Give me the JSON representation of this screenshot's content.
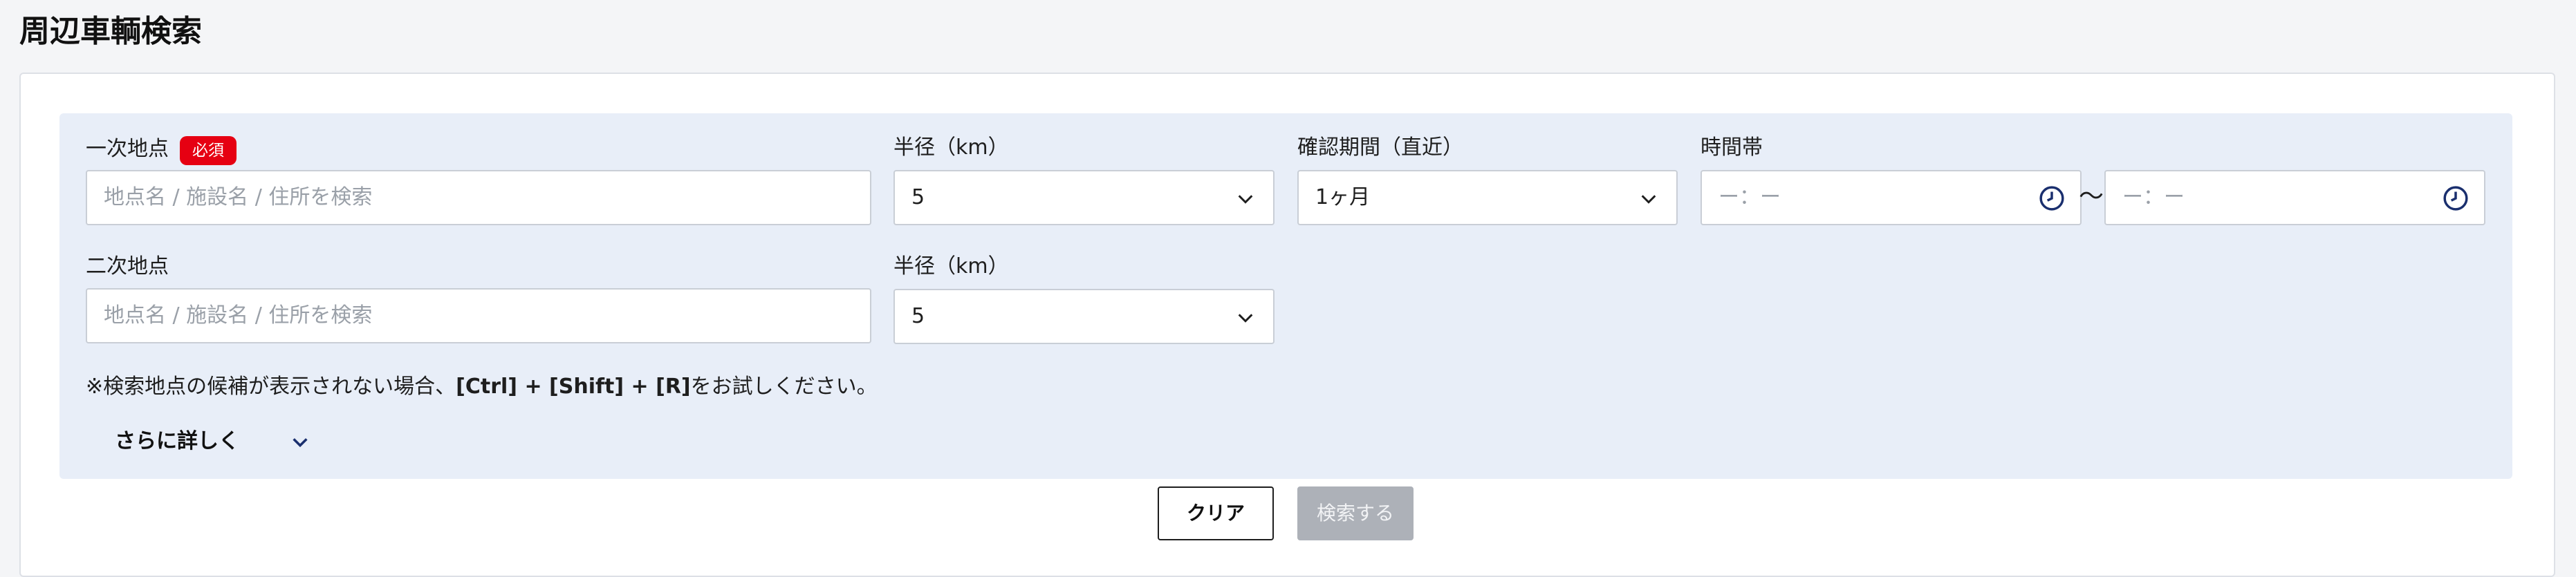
{
  "page": {
    "title": "周辺車輌検索"
  },
  "primary": {
    "label": "一次地点",
    "required_badge": "必須",
    "placeholder": "地点名 / 施設名 / 住所を検索"
  },
  "radius1": {
    "label": "半径（km）",
    "value": "5"
  },
  "period": {
    "label": "確認期間（直近）",
    "value": "1ヶ月"
  },
  "timeband": {
    "label": "時間帯",
    "from": "ー：ー",
    "separator": "〜",
    "to": "ー：ー"
  },
  "secondary": {
    "label": "二次地点",
    "placeholder": "地点名 / 施設名 / 住所を検索"
  },
  "radius2": {
    "label": "半径（km）",
    "value": "5"
  },
  "note": {
    "prefix": "※検索地点の候補が表示されない場合、",
    "keys": "[Ctrl] + [Shift] + [R]",
    "suffix": "をお試しください。"
  },
  "more": {
    "label": "さらに詳しく"
  },
  "buttons": {
    "clear": "クリア",
    "search": "検索する"
  },
  "colors": {
    "badge": "#e60012",
    "panel": "#e8eef8",
    "icon": "#1a2f6e",
    "disabled": "#adb1b8"
  },
  "icons": {
    "select": "chevron-down-icon",
    "time": "clock-icon"
  }
}
